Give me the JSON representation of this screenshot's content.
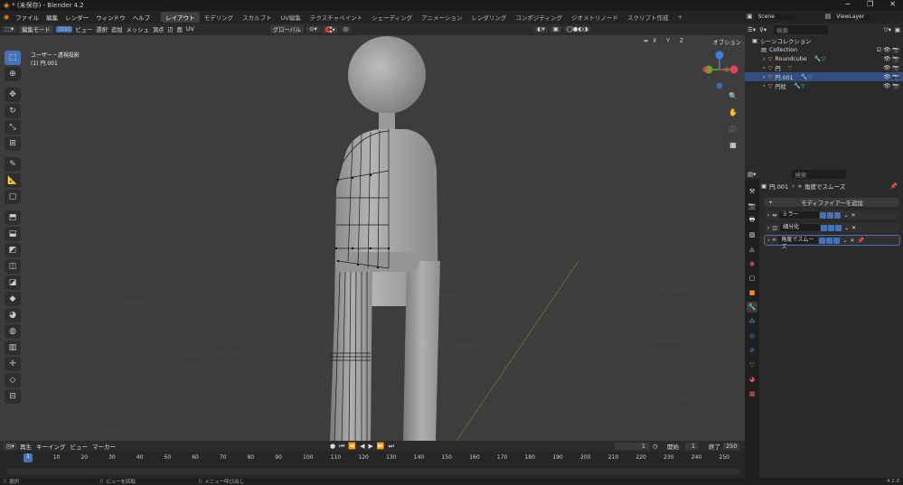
{
  "window": {
    "title": "* (未保存) - Blender 4.2",
    "minimize": "−",
    "restore": "❐",
    "close": "✕"
  },
  "menubar": {
    "items": [
      "ファイル",
      "編集",
      "レンダー",
      "ウィンドウ",
      "ヘルプ"
    ],
    "workspaces": [
      "レイアウト",
      "モデリング",
      "スカルプト",
      "UV編集",
      "テクスチャペイント",
      "シェーディング",
      "アニメーション",
      "レンダリング",
      "コンポジティング",
      "ジオメトリノード",
      "スクリプト作成"
    ],
    "add_workspace": "+",
    "scene": "Scene",
    "view_layer": "ViewLayer"
  },
  "viewport": {
    "mode": "編集モード",
    "menus": [
      "ビュー",
      "選択",
      "追加",
      "メッシュ",
      "頂点",
      "辺",
      "面",
      "UV"
    ],
    "orientation": "グローバル",
    "options": "オプション",
    "view_label": "ユーザー・透視投影",
    "object_label": "(1) 円.001",
    "axes": [
      "X",
      "Y",
      "Z"
    ]
  },
  "timeline": {
    "menus": [
      "再生",
      "キーイング",
      "ビュー",
      "マーカー"
    ],
    "current_frame": "1",
    "start_label": "開始",
    "start": "1",
    "end_label": "終了",
    "end": "250",
    "ticks": [
      "1",
      "10",
      "20",
      "30",
      "40",
      "50",
      "60",
      "70",
      "80",
      "90",
      "100",
      "110",
      "120",
      "130",
      "140",
      "150",
      "160",
      "170",
      "180",
      "190",
      "200",
      "210",
      "220",
      "230",
      "240",
      "250"
    ]
  },
  "statusbar": {
    "select": "選択",
    "rotate": "ビューを回転",
    "menu": "メニュー呼び出し",
    "version": "4.2.0"
  },
  "outliner": {
    "search_placeholder": "検索",
    "scene_collection": "シーンコレクション",
    "items": [
      {
        "name": "Collection",
        "selected": false
      },
      {
        "name": "Roundcube",
        "selected": false
      },
      {
        "name": "円",
        "selected": false
      },
      {
        "name": "円.001",
        "selected": true
      },
      {
        "name": "円柱",
        "selected": false
      }
    ]
  },
  "properties": {
    "search_placeholder": "検索",
    "object": "円.001",
    "modifier": "角度でスムーズ",
    "add_modifier": "モディファイアーを追加",
    "modifiers": [
      "ミラー",
      "細分化",
      "角度でスムーズ"
    ]
  },
  "colors": {
    "accent": "#4772b3",
    "selection": "#334d80",
    "viewport_bg": "#3d3d3d",
    "x_axis": "#e0435a",
    "y_axis": "#6ba32b",
    "z_axis": "#3d7fe0"
  }
}
